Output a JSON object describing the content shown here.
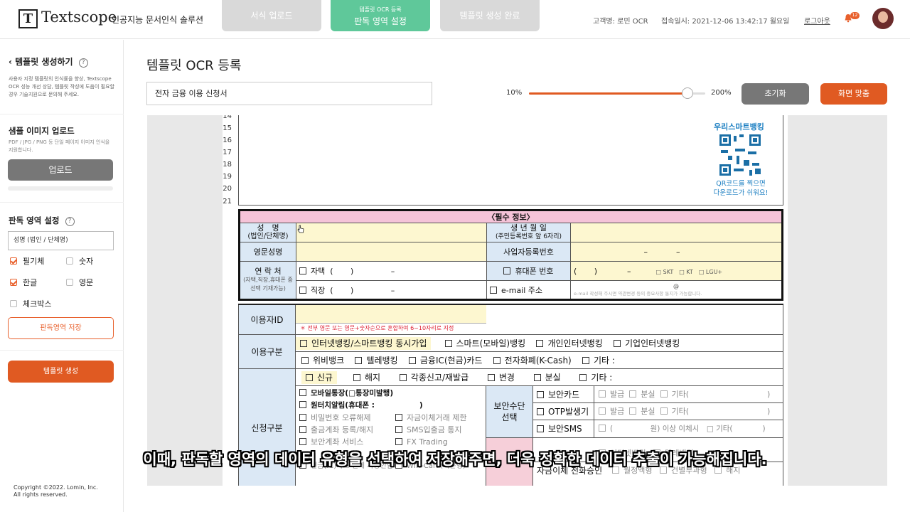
{
  "header": {
    "logo_mark": "T",
    "brand_name": "Textscope",
    "brand_sub": "인공지능 문서인식 솔루션",
    "steps": [
      {
        "label": "서식 업로드"
      },
      {
        "small": "템플릿 OCR 등록",
        "label": "판독 영역 설정"
      },
      {
        "label": "템플릿 생성 완료"
      }
    ],
    "customer": "고객명: 로민 OCR",
    "login_time": "접속일시: 2021-12-06 13:42:17 월요일",
    "logout": "로그아웃",
    "notification_count": "12",
    "accent_color": "#e8602c",
    "active_step_color": "#5fc89a"
  },
  "sidebar": {
    "back_label": "템플릿 생성하기",
    "help_glyph": "?",
    "description": "사용자 지정 템플릿의 인식률을 향상, Textscope OCR 성능 개선 상담, 템플릿 작성에 도움이 필요할 경우 기술지원으로 문의해 주세요.",
    "sample_title": "샘플 이미지 업로드",
    "sample_desc": "PDF / JPG / PNG 등 단일 페이지 이미지 인식을 지원합니다.",
    "upload_button": "업로드",
    "area_title": "판독 영역 설정",
    "area_select": "성명 (법인 / 단체명)",
    "checkboxes": [
      {
        "label": "필기체",
        "checked": true
      },
      {
        "label": "숫자",
        "checked": false
      },
      {
        "label": "한글",
        "checked": true
      },
      {
        "label": "영문",
        "checked": false
      },
      {
        "label": "체크박스",
        "checked": false
      }
    ],
    "save_area_button": "판독영역 저장",
    "create_button": "템플릿 생성",
    "copyright_line1": "Copyright ©2022. Lomin, Inc.",
    "copyright_line2": "All rights reserved."
  },
  "main": {
    "title": "템플릿 OCR 등록",
    "doc_name": "전자 금융 이용 신청서",
    "zoom_min": "10%",
    "zoom_max": "200%",
    "zoom_value": 0.9,
    "reset_button": "초기화",
    "fit_button": "화면 맞춤"
  },
  "document": {
    "line_numbers": [
      "14",
      "15",
      "16",
      "17",
      "18",
      "19",
      "20",
      "21"
    ],
    "qr_title": "우리스마트뱅킹",
    "qr_note1": "QR코드를 찍으면",
    "qr_note2": "다운로드가 쉬워요!",
    "section_title": "〈필수 정보〉",
    "name_label": "성　명",
    "name_sub": "(법인/단체명)",
    "birth_label": "생 년 월 일",
    "birth_sub": "(주민등록번호 앞 6자리)",
    "eng_name": "영문성명",
    "biz_no": "사업자등록번호",
    "contact_label": "연 락 처",
    "contact_sub": "(자택,직장,휴대폰 중 선택 기재가능)",
    "home": "자택",
    "work": "직장",
    "phone_open": "(",
    "phone_close": ")",
    "dash": "–",
    "mobile": "휴대폰 번호",
    "carriers": "□ SKT　□ KT　□ LGU+",
    "email": "e-mail 주소",
    "email_at": "@",
    "email_note": "e-mail 작성해 주시면 약관변경 등의 중요사항 통지가 가능합니다.",
    "user_id": "이용자ID",
    "user_id_note": "＊ 전부 영문 또는 영문+숫자순으로 혼합하여 6~10자리로 지정",
    "usage": "이용구분",
    "usage_items1": [
      "인터넷뱅킹/스마트뱅킹 동시가입",
      "스마트(모바일)뱅킹",
      "개인인터넷뱅킹",
      "기업인터넷뱅킹"
    ],
    "usage_items2": [
      "위비뱅크",
      "텔레뱅킹",
      "금융IC(현금)카드",
      "전자화폐(K-Cash)",
      "기타 :"
    ],
    "apply_items": [
      "신규",
      "해지",
      "각종신고/재발급",
      "변경",
      "분실",
      "기타 :"
    ],
    "apply_label": "신청구분",
    "mobile_items": [
      "모바일통장(□통장미발행)",
      "원터치알림(휴대폰 :　　　　　　)"
    ],
    "grey_items": [
      "비밀번호 오류해제",
      "자금이체거래 제한",
      "출금계좌 등록/해지",
      "SMS입출금 통지",
      "보안계좌 서비스",
      "FX Trading",
      "현금(IC)카드 결제 사용안함",
      "WIN-Card(기본형)"
    ],
    "security_label1": "보안수단",
    "security_label2": "선택",
    "security_items": [
      "보안카드",
      "OTP발생기",
      "보안SMS"
    ],
    "sec_opts": [
      "발급",
      "분실",
      "기타(　　　　　　　　　　)"
    ],
    "sms_opt": "(　　　　　원) 이상 이체시　□ 기타(　　　　)",
    "internet_opts": [
      "인터넷뱅킹",
      "텔레뱅킹"
    ],
    "transfer_label": "자금이체 전화승인",
    "transfer_opts": [
      "월정액형",
      "건별부과형",
      "해지"
    ]
  },
  "subtitle": "이때, 판독할 영역의 데이터 유형을 선택하여 저장해주면, 더욱 정확한 데이터 추출이 가능해집니다."
}
